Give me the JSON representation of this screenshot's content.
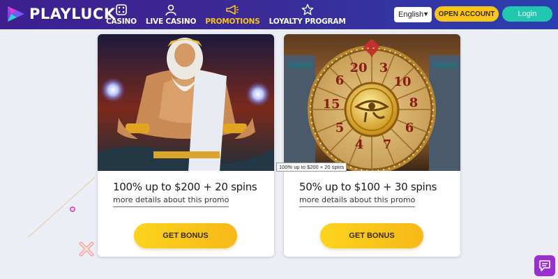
{
  "header": {
    "logo_text": "PLAYLUCK",
    "nav": [
      {
        "label": "CASINO",
        "icon": "dice-icon",
        "active": false
      },
      {
        "label": "LIVE CASINO",
        "icon": "dealer-icon",
        "active": false
      },
      {
        "label": "PROMOTIONS",
        "icon": "megaphone-icon",
        "active": true
      },
      {
        "label": "LOYALTY PROGRAM",
        "icon": "star-icon",
        "active": false
      }
    ],
    "language": "English",
    "open_account": "OPEN ACCOUNT",
    "login": "Login"
  },
  "promos": [
    {
      "title": "100% up to $200 + 20 spins",
      "link": "more details about this promo",
      "button": "GET BONUS",
      "image": "zeus-promo-image"
    },
    {
      "title": "50% up to $100 + 30 spins",
      "link": "more details about this promo",
      "button": "GET BONUS",
      "image": "wheel-of-fortune-promo-image"
    }
  ],
  "tooltip": "100% up to $200 + 20 spins",
  "colors": {
    "header_start": "#3d1f8e",
    "header_end": "#2b3fb0",
    "accent_yellow": "#f7c51c",
    "login_teal": "#21c7ae",
    "chat_purple": "#9a2fd0"
  }
}
